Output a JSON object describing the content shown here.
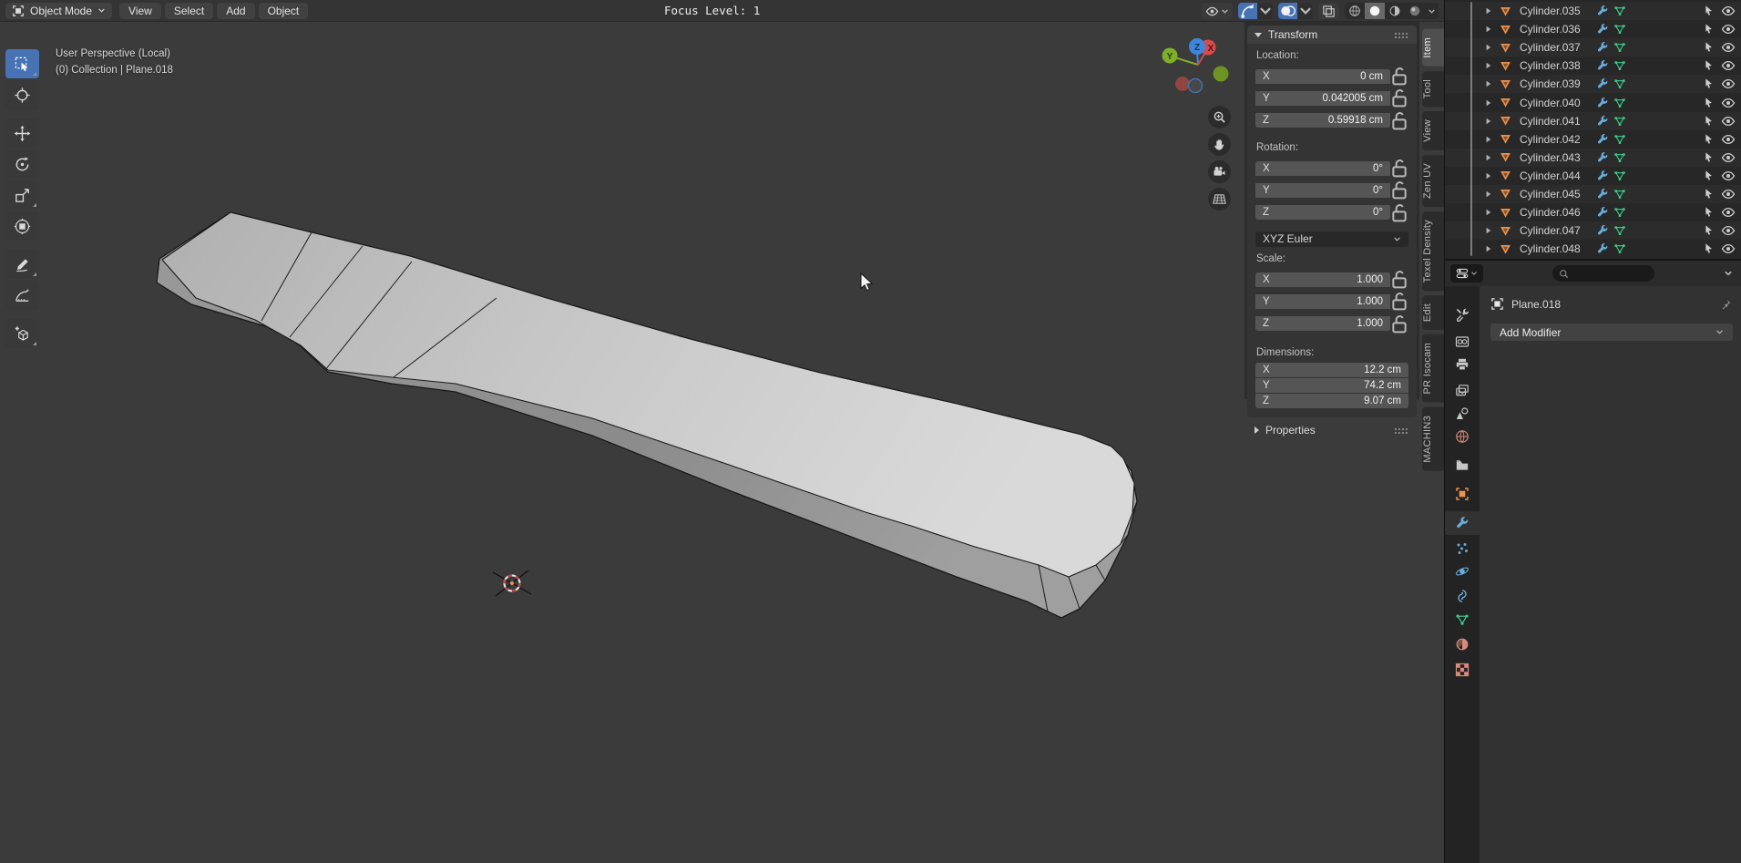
{
  "header": {
    "mode": "Object Mode",
    "menus": [
      "View",
      "Select",
      "Add",
      "Object"
    ],
    "focus_overlay": "Focus Level: 1"
  },
  "viewport": {
    "info_lines": [
      "User Perspective (Local)",
      "(0) Collection | Plane.018"
    ],
    "tools": [
      {
        "name": "tool-select-box",
        "icon": "select-box-icon",
        "active": true,
        "corner": true,
        "gap": false
      },
      {
        "name": "tool-cursor",
        "icon": "cursor-icon",
        "active": false,
        "corner": false,
        "gap": false
      },
      {
        "name": "tool-move",
        "icon": "move-icon",
        "active": false,
        "corner": false,
        "gap": true
      },
      {
        "name": "tool-rotate",
        "icon": "rotate-icon",
        "active": false,
        "corner": false,
        "gap": false
      },
      {
        "name": "tool-scale",
        "icon": "scale-icon",
        "active": false,
        "corner": true,
        "gap": false
      },
      {
        "name": "tool-transform",
        "icon": "transform-icon",
        "active": false,
        "corner": false,
        "gap": false
      },
      {
        "name": "tool-annotate",
        "icon": "annotate-icon",
        "active": false,
        "corner": true,
        "gap": true
      },
      {
        "name": "tool-measure",
        "icon": "measure-icon",
        "active": false,
        "corner": false,
        "gap": false
      },
      {
        "name": "tool-add-cube",
        "icon": "add-cube-icon",
        "active": false,
        "corner": true,
        "gap": true
      }
    ],
    "gizmo_axes": [
      "Y",
      "Z",
      "X"
    ]
  },
  "sidebar": {
    "transform_title": "Transform",
    "sections": {
      "location": {
        "label": "Location:",
        "locks": "open",
        "rows": [
          {
            "axis": "X",
            "value": "0 cm"
          },
          {
            "axis": "Y",
            "value": "0.042005 cm"
          },
          {
            "axis": "Z",
            "value": "0.59918 cm"
          }
        ]
      },
      "rotation": {
        "label": "Rotation:",
        "locks": "open",
        "rows": [
          {
            "axis": "X",
            "value": "0°"
          },
          {
            "axis": "Y",
            "value": "0°"
          },
          {
            "axis": "Z",
            "value": "0°"
          }
        ]
      },
      "rotation_mode": "XYZ Euler",
      "scale": {
        "label": "Scale:",
        "locks": "open",
        "rows": [
          {
            "axis": "X",
            "value": "1.000"
          },
          {
            "axis": "Y",
            "value": "1.000"
          },
          {
            "axis": "Z",
            "value": "1.000"
          }
        ]
      },
      "dimensions": {
        "label": "Dimensions:",
        "locks": "none",
        "rows": [
          {
            "axis": "X",
            "value": "12.2 cm"
          },
          {
            "axis": "Y",
            "value": "74.2 cm"
          },
          {
            "axis": "Z",
            "value": "9.07 cm"
          }
        ]
      }
    },
    "collapsed_panel": "Properties",
    "tabs": [
      {
        "label": "Item",
        "active": true
      },
      {
        "label": "Tool",
        "active": false
      },
      {
        "label": "View",
        "active": false
      },
      {
        "label": "Zen UV",
        "active": false
      },
      {
        "label": "Texel Density",
        "active": false
      },
      {
        "label": "Edit",
        "active": false
      },
      {
        "label": "PR Isocam",
        "active": false
      },
      {
        "label": "MACHIN3",
        "active": false
      }
    ]
  },
  "outliner": {
    "items": [
      "Cylinder.035",
      "Cylinder.036",
      "Cylinder.037",
      "Cylinder.038",
      "Cylinder.039",
      "Cylinder.040",
      "Cylinder.041",
      "Cylinder.042",
      "Cylinder.043",
      "Cylinder.044",
      "Cylinder.045",
      "Cylinder.046",
      "Cylinder.047",
      "Cylinder.048"
    ]
  },
  "properties": {
    "active_object": "Plane.018",
    "add_modifier_label": "Add Modifier",
    "search_value": "",
    "tabs": [
      {
        "name": "tab-tool",
        "icon": "tool-icon",
        "color": "#c8c8c8",
        "active": false
      },
      {
        "name": "tab-render",
        "icon": "render-icon",
        "color": "#c8c8c8",
        "active": false
      },
      {
        "name": "tab-output",
        "icon": "output-icon",
        "color": "#c8c8c8",
        "active": false
      },
      {
        "name": "tab-view-layer",
        "icon": "view-layer-icon",
        "color": "#c8c8c8",
        "active": false
      },
      {
        "name": "tab-scene",
        "icon": "scene-icon",
        "color": "#c8c8c8",
        "active": false
      },
      {
        "name": "tab-world",
        "icon": "world-icon",
        "color": "#d98a7a",
        "active": false
      },
      {
        "name": "tab-collection",
        "icon": "collection-icon",
        "color": "#c8c8c8",
        "active": false
      },
      {
        "name": "tab-object",
        "icon": "object-icon",
        "color": "#e8954e",
        "active": false
      },
      {
        "name": "tab-modifiers",
        "icon": "wrench-icon",
        "color": "#6aacdc",
        "active": true
      },
      {
        "name": "tab-particles",
        "icon": "particles-icon",
        "color": "#6aacdc",
        "active": false
      },
      {
        "name": "tab-physics",
        "icon": "physics-icon",
        "color": "#6aacdc",
        "active": false
      },
      {
        "name": "tab-constraints",
        "icon": "constraints-icon",
        "color": "#6aacdc",
        "active": false
      },
      {
        "name": "tab-data",
        "icon": "mesh-data-icon",
        "color": "#3fcf95",
        "active": false
      },
      {
        "name": "tab-material",
        "icon": "material-icon",
        "color": "#d98a7a",
        "active": false
      },
      {
        "name": "tab-texture",
        "icon": "texture-icon",
        "color": "#d98a7a",
        "active": false
      }
    ]
  },
  "colors": {
    "accent_blue": "#4772b3",
    "object_orange": "#e8954e",
    "modifier_blue": "#6aacdc",
    "mesh_green": "#3fcf95",
    "axis_x_red": "#d84747",
    "axis_y_green": "#7fae2a",
    "axis_z_blue": "#3e86dc"
  }
}
